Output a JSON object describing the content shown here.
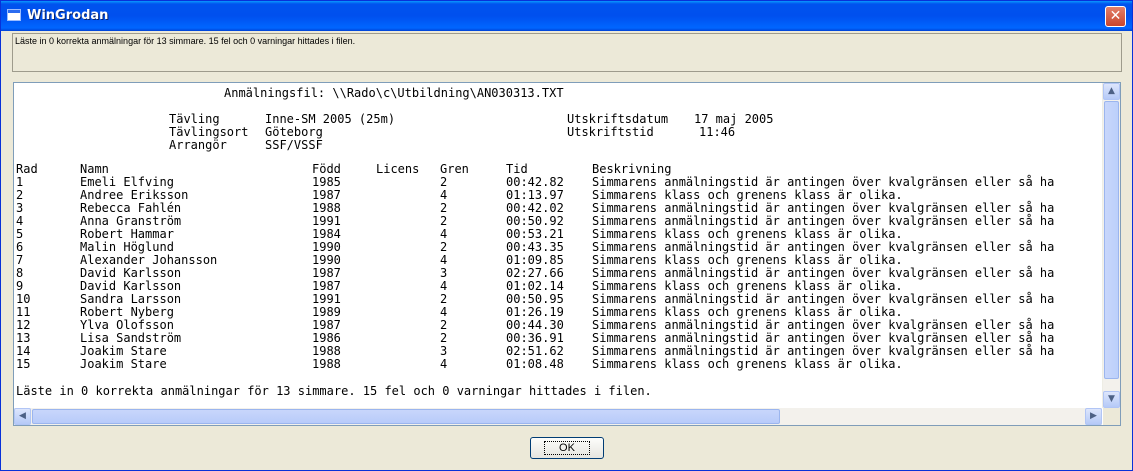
{
  "window": {
    "title": "WinGrodan",
    "close_glyph": "✕"
  },
  "status": {
    "message": "Läste in 0 korrekta anmälningar för 13 simmare. 15 fel och 0 varningar hittades i filen."
  },
  "report": {
    "file_line": "Anmälningsfil: \\\\Rado\\c\\Utbildning\\AN030313.TXT",
    "meta": [
      {
        "label": "Tävling",
        "value": "Inne-SM 2005 (25m)"
      },
      {
        "label": "Tävlingsort",
        "value": "Göteborg"
      },
      {
        "label": "Arrangör",
        "value": "SSF/VSSF"
      }
    ],
    "print_meta": [
      {
        "label": "Utskriftsdatum",
        "value": "17 maj 2005"
      },
      {
        "label": "Utskriftstid",
        "value": "11:46"
      }
    ],
    "columns": [
      "Rad",
      "Namn",
      "Född",
      "Licens",
      "Gren",
      "Tid",
      "Beskrivning"
    ],
    "rows": [
      {
        "rad": "1",
        "namn": "Emeli Elfving",
        "fodd": "1985",
        "licens": "",
        "gren": "2",
        "tid": "00:42.82",
        "beskrivning": "Simmarens anmälningstid är antingen över kvalgränsen eller så ha"
      },
      {
        "rad": "2",
        "namn": "Andree Eriksson",
        "fodd": "1987",
        "licens": "",
        "gren": "4",
        "tid": "01:13.97",
        "beskrivning": "Simmarens klass och grenens klass är olika."
      },
      {
        "rad": "3",
        "namn": "Rebecca Fahlén",
        "fodd": "1988",
        "licens": "",
        "gren": "2",
        "tid": "00:42.02",
        "beskrivning": "Simmarens anmälningstid är antingen över kvalgränsen eller så ha"
      },
      {
        "rad": "4",
        "namn": "Anna Granström",
        "fodd": "1991",
        "licens": "",
        "gren": "2",
        "tid": "00:50.92",
        "beskrivning": "Simmarens anmälningstid är antingen över kvalgränsen eller så ha"
      },
      {
        "rad": "5",
        "namn": "Robert Hammar",
        "fodd": "1984",
        "licens": "",
        "gren": "4",
        "tid": "00:53.21",
        "beskrivning": "Simmarens klass och grenens klass är olika."
      },
      {
        "rad": "6",
        "namn": "Malin Höglund",
        "fodd": "1990",
        "licens": "",
        "gren": "2",
        "tid": "00:43.35",
        "beskrivning": "Simmarens anmälningstid är antingen över kvalgränsen eller så ha"
      },
      {
        "rad": "7",
        "namn": "Alexander Johansson",
        "fodd": "1990",
        "licens": "",
        "gren": "4",
        "tid": "01:09.85",
        "beskrivning": "Simmarens klass och grenens klass är olika."
      },
      {
        "rad": "8",
        "namn": "David Karlsson",
        "fodd": "1987",
        "licens": "",
        "gren": "3",
        "tid": "02:27.66",
        "beskrivning": "Simmarens anmälningstid är antingen över kvalgränsen eller så ha"
      },
      {
        "rad": "9",
        "namn": "David Karlsson",
        "fodd": "1987",
        "licens": "",
        "gren": "4",
        "tid": "01:02.14",
        "beskrivning": "Simmarens klass och grenens klass är olika."
      },
      {
        "rad": "10",
        "namn": "Sandra Larsson",
        "fodd": "1991",
        "licens": "",
        "gren": "2",
        "tid": "00:50.95",
        "beskrivning": "Simmarens anmälningstid är antingen över kvalgränsen eller så ha"
      },
      {
        "rad": "11",
        "namn": "Robert Nyberg",
        "fodd": "1989",
        "licens": "",
        "gren": "4",
        "tid": "01:26.19",
        "beskrivning": "Simmarens klass och grenens klass är olika."
      },
      {
        "rad": "12",
        "namn": "Ylva Olofsson",
        "fodd": "1987",
        "licens": "",
        "gren": "2",
        "tid": "00:44.30",
        "beskrivning": "Simmarens anmälningstid är antingen över kvalgränsen eller så ha"
      },
      {
        "rad": "13",
        "namn": "Lisa Sandström",
        "fodd": "1986",
        "licens": "",
        "gren": "2",
        "tid": "00:36.91",
        "beskrivning": "Simmarens anmälningstid är antingen över kvalgränsen eller så ha"
      },
      {
        "rad": "14",
        "namn": "Joakim Stare",
        "fodd": "1988",
        "licens": "",
        "gren": "3",
        "tid": "02:51.62",
        "beskrivning": "Simmarens anmälningstid är antingen över kvalgränsen eller så ha"
      },
      {
        "rad": "15",
        "namn": "Joakim Stare",
        "fodd": "1988",
        "licens": "",
        "gren": "4",
        "tid": "01:08.48",
        "beskrivning": "Simmarens klass och grenens klass är olika."
      }
    ],
    "summary": "Läste in 0 korrekta anmälningar för 13 simmare. 15 fel och 0 varningar hittades i filen."
  },
  "scrollbar": {
    "up_glyph": "▲",
    "down_glyph": "▼",
    "left_glyph": "◀",
    "right_glyph": "▶"
  },
  "ok_label": "OK"
}
